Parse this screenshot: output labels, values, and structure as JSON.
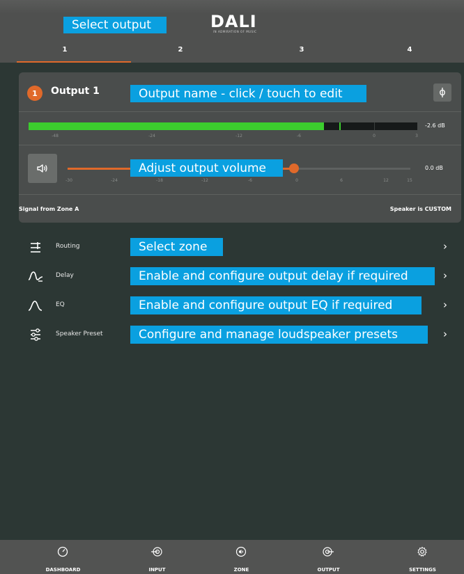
{
  "header": {
    "logo_text": "DALI",
    "logo_tagline": "IN ADMIRATION OF MUSIC",
    "tabs": [
      {
        "label": "1",
        "active": true
      },
      {
        "label": "2",
        "active": false
      },
      {
        "label": "3",
        "active": false
      },
      {
        "label": "4",
        "active": false
      }
    ]
  },
  "callouts": {
    "select_output": "Select output",
    "output_name": "Output name - click / touch to edit",
    "adjust_volume": "Adjust output volume",
    "select_zone": "Select zone",
    "delay": "Enable and configure output delay if required",
    "eq": "Enable and configure output EQ if required",
    "speaker_preset": "Configure and manage loudspeaker presets"
  },
  "output": {
    "badge": "1",
    "title": "Output 1",
    "phase_icon": "phase-icon",
    "meter": {
      "level": 0.76,
      "peak": 0.8,
      "value": "-2.6 dB",
      "ticks": [
        "-48",
        "-24",
        "-12",
        "-6",
        "0",
        "3"
      ]
    },
    "volume": {
      "value": "0.0 dB",
      "position": 0.66,
      "ticks": [
        "-30",
        "-24",
        "-18",
        "-12",
        "-6",
        "0",
        "6",
        "12",
        "15"
      ]
    },
    "signal_source": "Signal from Zone A",
    "speaker_type": "Speaker is CUSTOM"
  },
  "menu": [
    {
      "label": "Routing",
      "icon": "routing-icon"
    },
    {
      "label": "Delay",
      "icon": "delay-icon"
    },
    {
      "label": "EQ",
      "icon": "eq-icon"
    },
    {
      "label": "Speaker Preset",
      "icon": "sliders-icon"
    }
  ],
  "nav": [
    {
      "label": "DASHBOARD",
      "icon": "gauge-icon"
    },
    {
      "label": "INPUT",
      "icon": "input-icon"
    },
    {
      "label": "ZONE",
      "icon": "zone-icon"
    },
    {
      "label": "OUTPUT",
      "icon": "output-icon"
    },
    {
      "label": "SETTINGS",
      "icon": "gear-icon"
    }
  ],
  "colors": {
    "accent": "#e0692a",
    "callout": "#0aa0e0",
    "meter_green": "#3ccd2e",
    "background": "#2c3734"
  }
}
